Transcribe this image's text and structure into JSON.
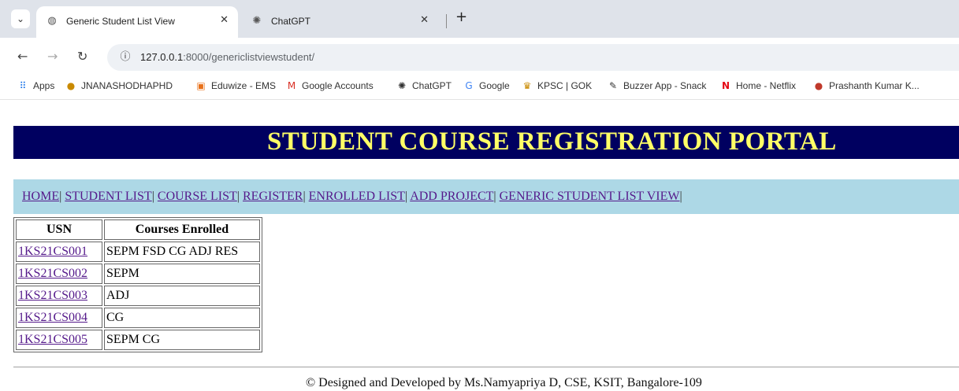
{
  "browser": {
    "tabs": [
      {
        "title": "Generic Student List View",
        "icon": "globe-icon",
        "active": true
      },
      {
        "title": "ChatGPT",
        "icon": "chatgpt-icon",
        "active": false
      }
    ],
    "url_host": "127.0.0.1",
    "url_path": ":8000/genericlistviewstudent/",
    "bookmarks": [
      {
        "label": "Apps",
        "icon": "apps-grid-icon"
      },
      {
        "label": "JNANASHODHAPHD",
        "icon": "pin-icon"
      },
      {
        "label": "Eduwize - EMS",
        "icon": "eduwize-icon"
      },
      {
        "label": "Google Accounts",
        "icon": "gmail-icon"
      },
      {
        "label": "ChatGPT",
        "icon": "chatgpt-icon"
      },
      {
        "label": "Google",
        "icon": "google-icon"
      },
      {
        "label": "KPSC | GOK",
        "icon": "kpsc-icon"
      },
      {
        "label": "Buzzer App - Snack",
        "icon": "buzzer-icon"
      },
      {
        "label": "Home - Netflix",
        "icon": "netflix-icon"
      },
      {
        "label": "Prashanth Kumar K...",
        "icon": "profile-icon"
      }
    ]
  },
  "page": {
    "title": "STUDENT COURSE REGISTRATION PORTAL",
    "nav": [
      "HOME",
      "STUDENT LIST",
      "COURSE LIST",
      "REGISTER",
      "ENROLLED LIST",
      "ADD PROJECT",
      "GENERIC STUDENT LIST VIEW"
    ],
    "nav_separator": "|",
    "table": {
      "headers": [
        "USN",
        "Courses Enrolled"
      ],
      "rows": [
        {
          "usn": "1KS21CS001",
          "courses": "SEPM FSD CG ADJ RES"
        },
        {
          "usn": "1KS21CS002",
          "courses": "SEPM"
        },
        {
          "usn": "1KS21CS003",
          "courses": "ADJ"
        },
        {
          "usn": "1KS21CS004",
          "courses": "CG"
        },
        {
          "usn": "1KS21CS005",
          "courses": "SEPM CG"
        }
      ]
    },
    "footer": "© Designed and Developed by Ms.Namyapriya D, CSE, KSIT, Bangalore-109"
  },
  "colors": {
    "banner_bg": "#000060",
    "banner_text": "#ffff66",
    "nav_bg": "#add8e6",
    "link": "#551a8b"
  }
}
